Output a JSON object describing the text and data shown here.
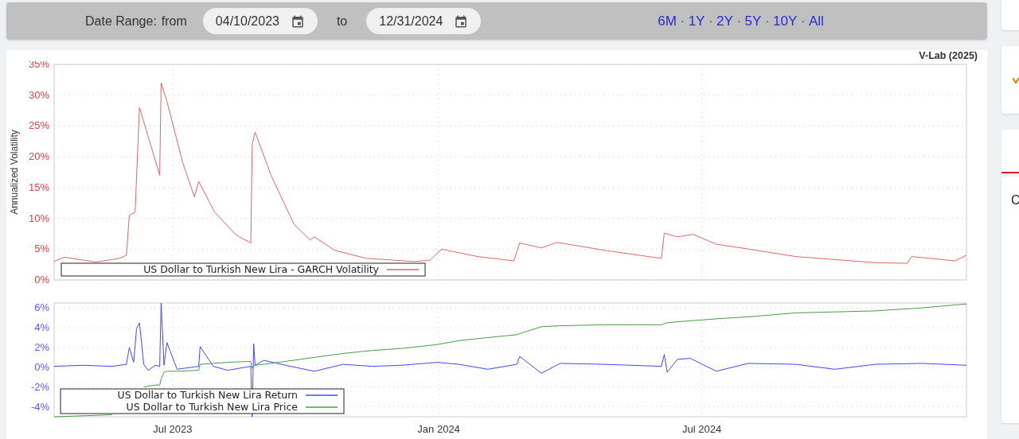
{
  "toolbar": {
    "label": "Date Range:",
    "from_label": "from",
    "from_value": "04/10/2023",
    "to_label": "to",
    "to_value": "12/31/2024",
    "separator": "·",
    "ranges": [
      "6M",
      "1Y",
      "2Y",
      "5Y",
      "10Y",
      "All"
    ]
  },
  "credit": "V-Lab (2025)",
  "volatility_chart": {
    "chart_data": {
      "type": "line",
      "grid": true,
      "legend": "lower left",
      "ylabel": "Annualized Volatility",
      "xlim": [
        "2023-04-10",
        "2024-12-31"
      ],
      "ylim": [
        0,
        35
      ],
      "x": [
        "2023-04-10",
        "2023-04-17",
        "2023-05-09",
        "2023-05-25",
        "2023-05-30",
        "2023-06-01",
        "2023-06-05",
        "2023-06-08",
        "2023-06-22",
        "2023-06-23",
        "2023-06-27",
        "2023-07-08",
        "2023-07-16",
        "2023-07-19",
        "2023-07-30",
        "2023-08-13",
        "2023-08-16",
        "2023-08-24",
        "2023-08-25",
        "2023-08-27",
        "2023-09-07",
        "2023-09-23",
        "2023-10-04",
        "2023-10-07",
        "2023-10-21",
        "2023-11-12",
        "2023-12-15",
        "2023-12-26",
        "2024-01-03",
        "2024-01-28",
        "2024-02-22",
        "2024-02-26",
        "2024-03-12",
        "2024-03-23",
        "2024-04-25",
        "2024-06-03",
        "2024-06-05",
        "2024-06-14",
        "2024-06-25",
        "2024-07-11",
        "2024-07-28",
        "2024-09-04",
        "2024-10-29",
        "2024-11-20",
        "2024-11-23",
        "2024-12-23",
        "2024-12-31"
      ],
      "yticks": [
        {
          "value": 0,
          "label": "0%"
        },
        {
          "value": 5,
          "label": "5%"
        },
        {
          "value": 10,
          "label": "10%"
        },
        {
          "value": 15,
          "label": "15%"
        },
        {
          "value": 20,
          "label": "20%"
        },
        {
          "value": 25,
          "label": "25%"
        },
        {
          "value": 30,
          "label": "30%"
        },
        {
          "value": 35,
          "label": "35%"
        }
      ],
      "series": [
        {
          "name": "US Dollar to Turkish New Lira - GARCH Volatility",
          "color": "#e06666",
          "values": [
            3.0,
            3.7,
            2.9,
            3.5,
            4.0,
            10.5,
            11,
            28,
            17,
            32,
            29,
            19,
            13.5,
            16,
            11,
            7.5,
            7,
            6,
            22,
            24,
            17,
            9,
            6.5,
            7,
            4.8,
            3.5,
            3,
            3.2,
            5,
            3.8,
            3.1,
            6,
            5.2,
            6.1,
            4.8,
            3.5,
            7.6,
            7,
            7.4,
            5.8,
            5.2,
            3.8,
            2.8,
            2.7,
            3.8,
            3.1,
            4.0
          ]
        }
      ]
    }
  },
  "returns_chart": {
    "chart_data": {
      "type": "line",
      "grid": true,
      "legend": "lower left",
      "xlim": [
        "2023-04-10",
        "2024-12-31"
      ],
      "ylim": [
        -5,
        6.5
      ],
      "x": [
        "2023-04-10",
        "2023-04-30",
        "2023-05-20",
        "2023-05-30",
        "2023-06-01",
        "2023-06-04",
        "2023-06-06",
        "2023-06-08",
        "2023-06-11",
        "2023-06-14",
        "2023-06-19",
        "2023-06-22",
        "2023-06-23",
        "2023-06-25",
        "2023-06-27",
        "2023-07-04",
        "2023-07-19",
        "2023-07-20",
        "2023-07-29",
        "2023-08-08",
        "2023-08-24",
        "2023-08-25",
        "2023-08-26",
        "2023-08-27",
        "2023-09-02",
        "2023-09-17",
        "2023-10-07",
        "2023-10-27",
        "2023-11-16",
        "2023-12-06",
        "2023-12-31",
        "2024-01-15",
        "2024-02-04",
        "2024-02-24",
        "2024-02-26",
        "2024-03-12",
        "2024-03-25",
        "2024-04-24",
        "2024-06-03",
        "2024-06-05",
        "2024-06-07",
        "2024-06-14",
        "2024-06-23",
        "2024-07-11",
        "2024-08-02",
        "2024-09-04",
        "2024-10-01",
        "2024-10-29",
        "2024-11-30",
        "2024-12-31"
      ],
      "xticks": [
        {
          "value": "2023-07-01",
          "label": "Jul 2023"
        },
        {
          "value": "2024-01-01",
          "label": "Jan 2024"
        },
        {
          "value": "2024-07-01",
          "label": "Jul 2024"
        }
      ],
      "yticks": [
        {
          "value": -4,
          "label": "-4%"
        },
        {
          "value": -2,
          "label": "-2%"
        },
        {
          "value": 0,
          "label": "0%"
        },
        {
          "value": 2,
          "label": "2%"
        },
        {
          "value": 4,
          "label": "4%"
        },
        {
          "value": 6,
          "label": "6%"
        }
      ],
      "series": [
        {
          "name": "US Dollar to Turkish New Lira Return",
          "color": "#4444ff",
          "values": [
            0.1,
            0.2,
            0.1,
            0.3,
            2.0,
            0.5,
            3.9,
            4.5,
            0.3,
            -0.3,
            0.2,
            0.1,
            6.5,
            0.2,
            2.5,
            -0.2,
            0.1,
            2.1,
            0.1,
            -0.3,
            0.1,
            -5,
            2.4,
            0.2,
            0.7,
            0.2,
            -0.4,
            0.3,
            0.1,
            0.2,
            0.5,
            0.3,
            -0.2,
            0.3,
            1.1,
            -0.6,
            0.4,
            0.3,
            0.1,
            1.3,
            -0.5,
            0.8,
            0.9,
            -0.4,
            0.4,
            0.3,
            -0.2,
            0.3,
            0.4,
            0.2
          ]
        },
        {
          "name": "US Dollar to Turkish New Lira Price",
          "color": "#4a9a4a",
          "values": [
            -5,
            -4.9,
            -4.8,
            null,
            null,
            null,
            null,
            null,
            -2.0,
            -1.9,
            -1.8,
            -1.8,
            -1.2,
            -0.5,
            -0.4,
            -0.4,
            -0.3,
            0.3,
            0.4,
            0.5,
            0.6,
            -0.1,
            0.1,
            0.2,
            0.3,
            0.6,
            1.0,
            1.4,
            1.7,
            1.9,
            2.3,
            2.7,
            3.0,
            3.3,
            3.4,
            4.1,
            4.2,
            4.3,
            4.3,
            4.4,
            4.5,
            4.6,
            4.7,
            4.9,
            5.1,
            5.5,
            5.6,
            5.7,
            6.0,
            6.4
          ]
        }
      ]
    }
  },
  "right_panel": {
    "text": "C"
  }
}
